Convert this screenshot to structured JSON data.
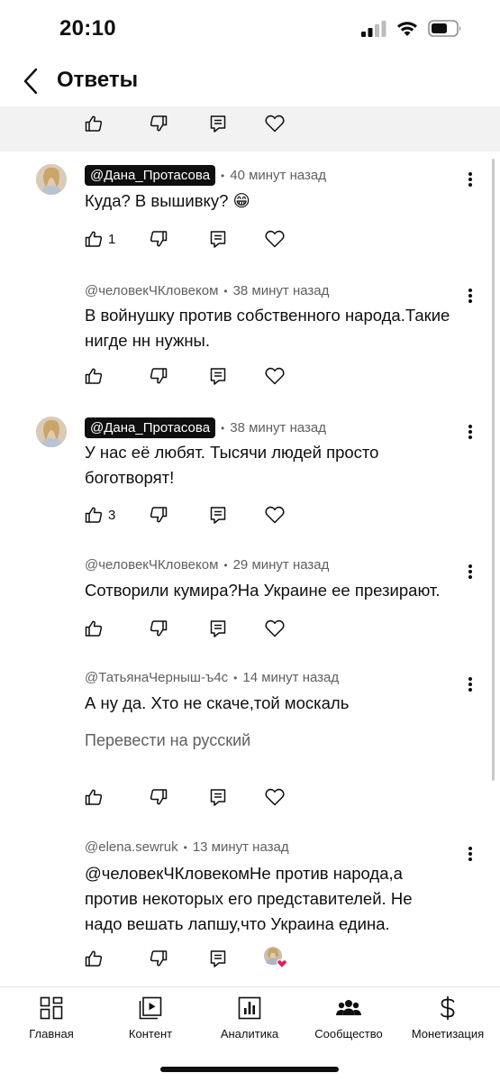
{
  "status_bar": {
    "time": "20:10"
  },
  "header": {
    "title": "Ответы"
  },
  "comments": [
    {
      "author": "@Дана_Протасова",
      "time": "40 минут назад",
      "text": "Куда? В вышивку? 😁",
      "likes": "1"
    },
    {
      "author": "@человекЧКловеком",
      "time": "38 минут назад",
      "text": "В войнушку против собственного народа.Такие нигде нн нужны.",
      "likes": ""
    },
    {
      "author": "@Дана_Протасова",
      "time": "38 минут назад",
      "text": "У нас её любят. Тысячи людей просто боготворят!",
      "likes": "3"
    },
    {
      "author": "@человекЧКловеком",
      "time": "29 минут назад",
      "text": "Сотворили кумира?На Украине ее презирают.",
      "likes": ""
    },
    {
      "author": "@ТатьянаЧерныш-ъ4с",
      "time": "14 минут назад",
      "text": "А ну да. Хто не скаче,той москаль",
      "likes": "",
      "translate": "Перевести на русский"
    },
    {
      "author": "@elena.sewruk",
      "time": "13 минут назад",
      "text": "@человекЧКловекомНе против народа,а против некоторых его представителей. Не надо вешать лапшу,что Украина едина.",
      "likes": ""
    }
  ],
  "separator": "•",
  "bottom_nav": [
    {
      "label": "Главная",
      "icon": "home-grid-icon"
    },
    {
      "label": "Контент",
      "icon": "content-play-icon"
    },
    {
      "label": "Аналитика",
      "icon": "analytics-chart-icon"
    },
    {
      "label": "Сообщество",
      "icon": "community-people-icon"
    },
    {
      "label": "Монетизация",
      "icon": "dollar-icon"
    }
  ],
  "colors": {
    "text": "#0f0f0f",
    "secondary": "#606060",
    "strip": "#f2f2f2",
    "heart": "#e0245e"
  }
}
